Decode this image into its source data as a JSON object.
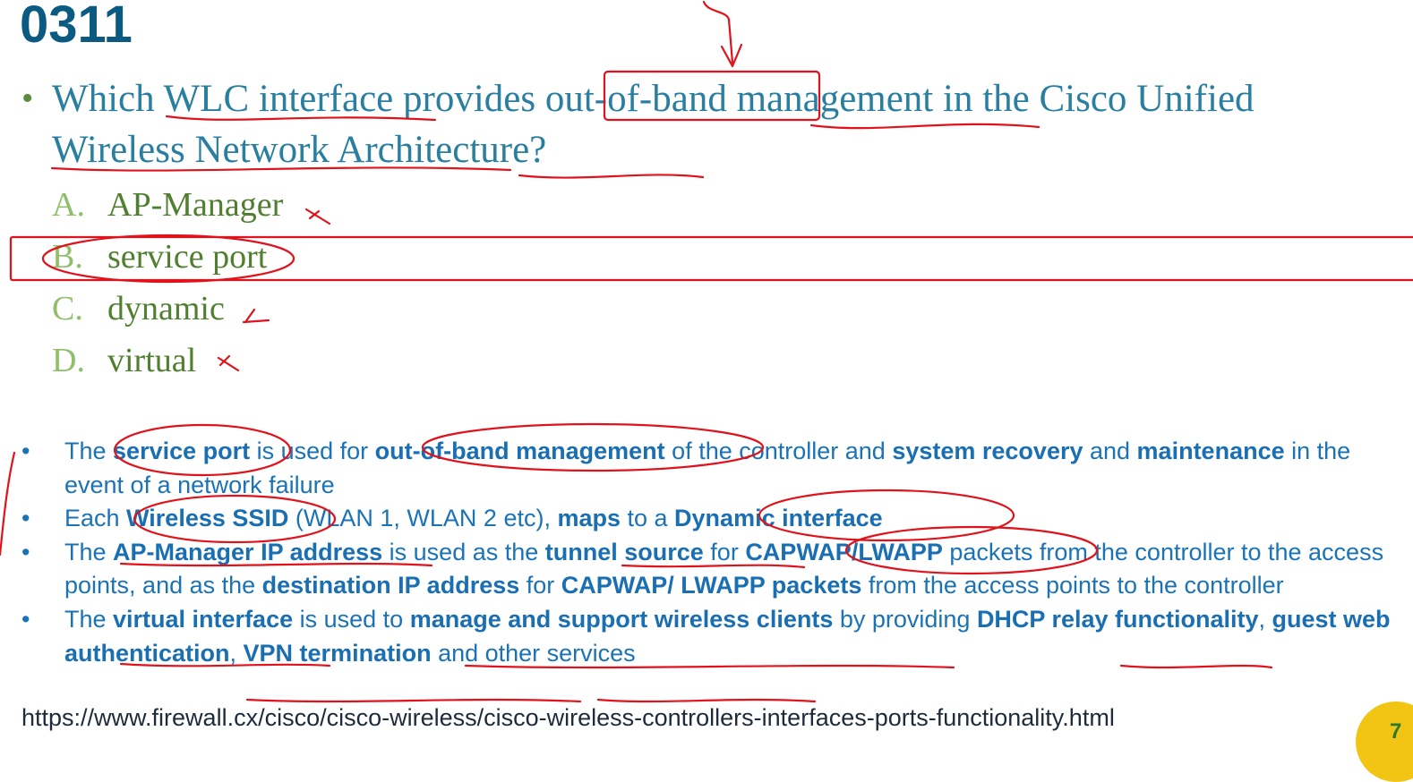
{
  "slide": {
    "title": "0311",
    "question_bullet": "•",
    "question": "Which WLC interface provides out-of-band management in the Cisco Unified Wireless Network Architecture?",
    "options": [
      {
        "letter": "A.",
        "text": "AP-Manager"
      },
      {
        "letter": "B.",
        "text": "service port"
      },
      {
        "letter": "C.",
        "text": "dynamic"
      },
      {
        "letter": "D.",
        "text": "virtual"
      }
    ],
    "selected_answer": "B.",
    "notes": {
      "bullet": "•",
      "n1": {
        "a": "The ",
        "b": "service port",
        "c": " is used for ",
        "d": "out-of-band management",
        "e": " of the controller and ",
        "f": "system recovery",
        "g": " and ",
        "h": "maintenance",
        "i": " in the event of a network failure"
      },
      "n2": {
        "a": "Each ",
        "b": "Wireless SSID",
        "c": " (WLAN 1, WLAN 2 etc), ",
        "d": "maps",
        "e": " to a ",
        "f": "Dynamic interface"
      },
      "n3": {
        "a": "The ",
        "b": "AP-Manager IP address",
        "c": " is used as the ",
        "d": "tunnel source",
        "e": " for ",
        "f": "CAPWAP/LWAPP",
        "g": " packets from the controller to the access points, and as the ",
        "h": "destination IP address",
        "i": " for ",
        "j": "CAPWAP/ LWAPP packets",
        "k": " from the access points to the controller"
      },
      "n4": {
        "a": "The ",
        "b": "virtual interface",
        "c": " is used to ",
        "d": "manage and support wireless clients",
        "e": " by providing ",
        "f": "DHCP relay functionality",
        "g": ", ",
        "h": "guest web authentication",
        "i": ", ",
        "j": "VPN termination",
        "k": " and other services"
      }
    },
    "source_url": "https://www.firewall.cx/cisco/cisco-wireless/cisco-wireless-controllers-interfaces-ports-functionality.html",
    "badge_text": "7",
    "colors": {
      "title": "#0b5a82",
      "question": "#2a7fa0",
      "options": "#4f7f2f",
      "notes": "#1a73b6",
      "annotation": "#e0121b",
      "badge": "#f2c515"
    }
  }
}
